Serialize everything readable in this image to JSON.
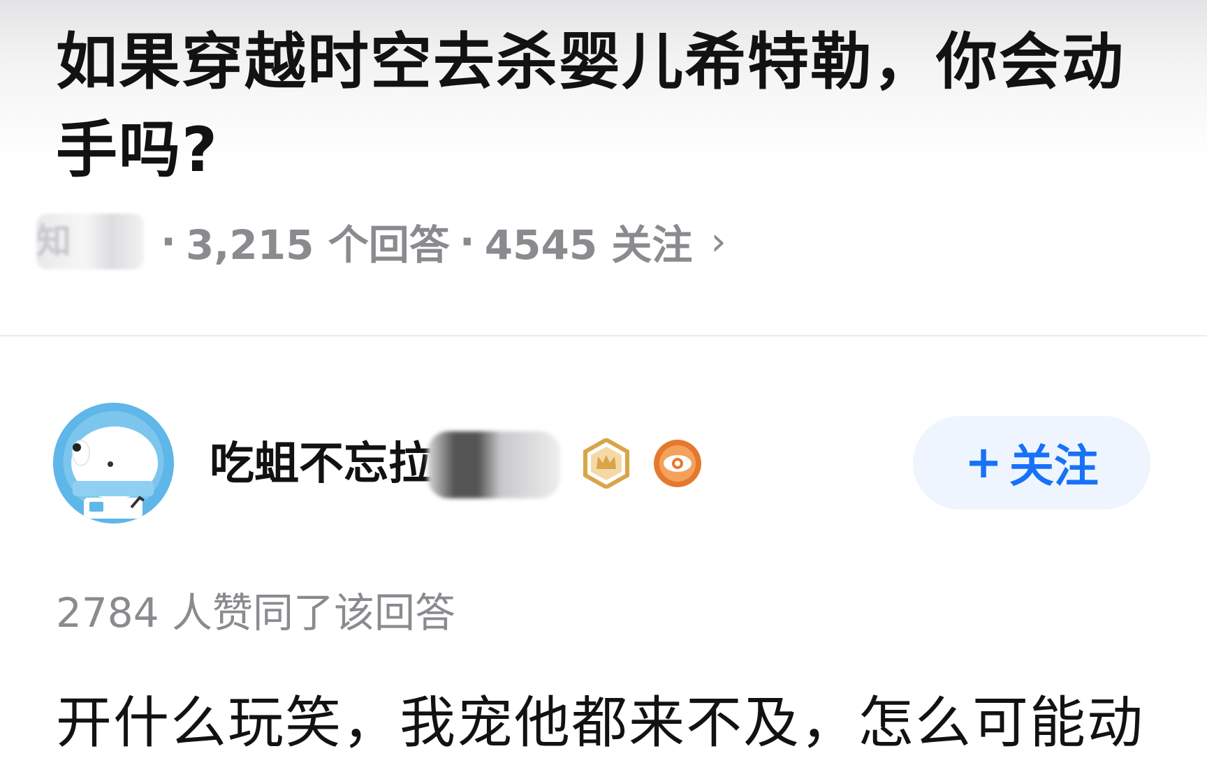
{
  "question": {
    "title": "如果穿越时空去杀婴儿希特勒，你会动手吗?",
    "topic_partial": "知",
    "answers_count": "3,215 个回答",
    "follow_count": "4545 关注",
    "separator": "·",
    "chevron_icon": "chevron-right-icon",
    "chevron_glyph": "›"
  },
  "author": {
    "name_visible": "吃蛆不忘拉",
    "name_suffix": "、",
    "avatar_icon": "astronaut-dog-avatar-icon",
    "badges": [
      "crown-badge-icon",
      "eye-badge-icon"
    ],
    "follow_plus": "+",
    "follow_label": "关注"
  },
  "answer": {
    "upvote_text": "2784 人赞同了该回答",
    "body_first_line": "开什么玩笑，我宠他都来不及，怎么可能动"
  },
  "colors": {
    "accent": "#1772f6",
    "follow_bg": "#eef5fe",
    "muted_text": "#8a8a8f",
    "title_text": "#121212",
    "avatar_bg": "#5fb6e8",
    "badge_gold": "#d9a54a",
    "badge_orange": "#e6782d"
  }
}
